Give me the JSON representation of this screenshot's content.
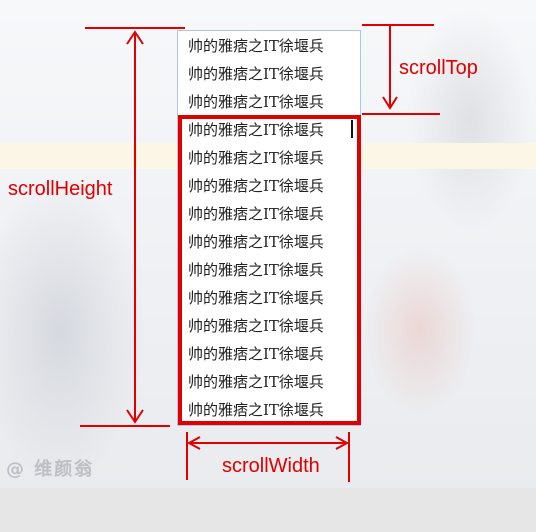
{
  "labels": {
    "scroll_top": "scrollTop",
    "scroll_height": "scrollHeight",
    "scroll_width": "scrollWidth"
  },
  "textarea": {
    "lines": [
      "帅的雅痞之IT徐堰兵",
      "帅的雅痞之IT徐堰兵",
      "帅的雅痞之IT徐堰兵",
      "帅的雅痞之IT徐堰兵",
      "帅的雅痞之IT徐堰兵",
      "帅的雅痞之IT徐堰兵",
      "帅的雅痞之IT徐堰兵",
      "帅的雅痞之IT徐堰兵",
      "帅的雅痞之IT徐堰兵",
      "帅的雅痞之IT徐堰兵",
      "帅的雅痞之IT徐堰兵",
      "帅的雅痞之IT徐堰兵",
      "帅的雅痞之IT徐堰兵",
      "帅的雅痞之IT徐堰兵"
    ]
  },
  "watermark": "@ 维颜翁",
  "colors": {
    "annotation": "#e00000",
    "textarea_border": "#aec6e3"
  }
}
